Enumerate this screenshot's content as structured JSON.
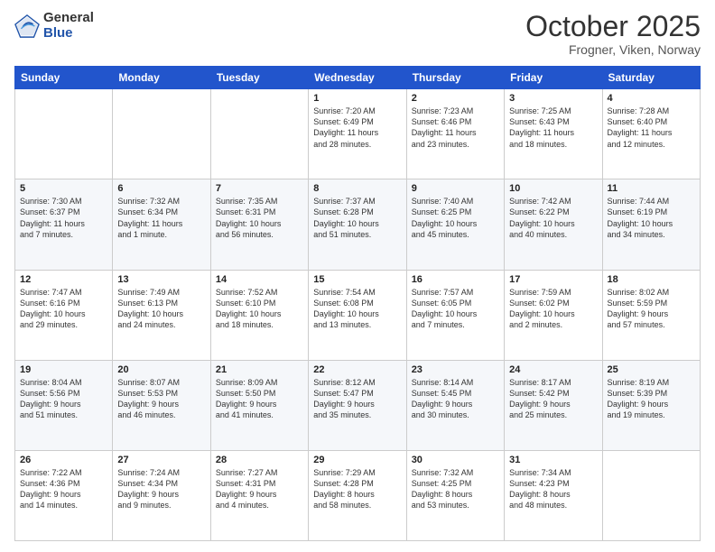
{
  "logo": {
    "general": "General",
    "blue": "Blue"
  },
  "title": "October 2025",
  "subtitle": "Frogner, Viken, Norway",
  "weekdays": [
    "Sunday",
    "Monday",
    "Tuesday",
    "Wednesday",
    "Thursday",
    "Friday",
    "Saturday"
  ],
  "weeks": [
    [
      {
        "day": "",
        "info": ""
      },
      {
        "day": "",
        "info": ""
      },
      {
        "day": "",
        "info": ""
      },
      {
        "day": "1",
        "info": "Sunrise: 7:20 AM\nSunset: 6:49 PM\nDaylight: 11 hours\nand 28 minutes."
      },
      {
        "day": "2",
        "info": "Sunrise: 7:23 AM\nSunset: 6:46 PM\nDaylight: 11 hours\nand 23 minutes."
      },
      {
        "day": "3",
        "info": "Sunrise: 7:25 AM\nSunset: 6:43 PM\nDaylight: 11 hours\nand 18 minutes."
      },
      {
        "day": "4",
        "info": "Sunrise: 7:28 AM\nSunset: 6:40 PM\nDaylight: 11 hours\nand 12 minutes."
      }
    ],
    [
      {
        "day": "5",
        "info": "Sunrise: 7:30 AM\nSunset: 6:37 PM\nDaylight: 11 hours\nand 7 minutes."
      },
      {
        "day": "6",
        "info": "Sunrise: 7:32 AM\nSunset: 6:34 PM\nDaylight: 11 hours\nand 1 minute."
      },
      {
        "day": "7",
        "info": "Sunrise: 7:35 AM\nSunset: 6:31 PM\nDaylight: 10 hours\nand 56 minutes."
      },
      {
        "day": "8",
        "info": "Sunrise: 7:37 AM\nSunset: 6:28 PM\nDaylight: 10 hours\nand 51 minutes."
      },
      {
        "day": "9",
        "info": "Sunrise: 7:40 AM\nSunset: 6:25 PM\nDaylight: 10 hours\nand 45 minutes."
      },
      {
        "day": "10",
        "info": "Sunrise: 7:42 AM\nSunset: 6:22 PM\nDaylight: 10 hours\nand 40 minutes."
      },
      {
        "day": "11",
        "info": "Sunrise: 7:44 AM\nSunset: 6:19 PM\nDaylight: 10 hours\nand 34 minutes."
      }
    ],
    [
      {
        "day": "12",
        "info": "Sunrise: 7:47 AM\nSunset: 6:16 PM\nDaylight: 10 hours\nand 29 minutes."
      },
      {
        "day": "13",
        "info": "Sunrise: 7:49 AM\nSunset: 6:13 PM\nDaylight: 10 hours\nand 24 minutes."
      },
      {
        "day": "14",
        "info": "Sunrise: 7:52 AM\nSunset: 6:10 PM\nDaylight: 10 hours\nand 18 minutes."
      },
      {
        "day": "15",
        "info": "Sunrise: 7:54 AM\nSunset: 6:08 PM\nDaylight: 10 hours\nand 13 minutes."
      },
      {
        "day": "16",
        "info": "Sunrise: 7:57 AM\nSunset: 6:05 PM\nDaylight: 10 hours\nand 7 minutes."
      },
      {
        "day": "17",
        "info": "Sunrise: 7:59 AM\nSunset: 6:02 PM\nDaylight: 10 hours\nand 2 minutes."
      },
      {
        "day": "18",
        "info": "Sunrise: 8:02 AM\nSunset: 5:59 PM\nDaylight: 9 hours\nand 57 minutes."
      }
    ],
    [
      {
        "day": "19",
        "info": "Sunrise: 8:04 AM\nSunset: 5:56 PM\nDaylight: 9 hours\nand 51 minutes."
      },
      {
        "day": "20",
        "info": "Sunrise: 8:07 AM\nSunset: 5:53 PM\nDaylight: 9 hours\nand 46 minutes."
      },
      {
        "day": "21",
        "info": "Sunrise: 8:09 AM\nSunset: 5:50 PM\nDaylight: 9 hours\nand 41 minutes."
      },
      {
        "day": "22",
        "info": "Sunrise: 8:12 AM\nSunset: 5:47 PM\nDaylight: 9 hours\nand 35 minutes."
      },
      {
        "day": "23",
        "info": "Sunrise: 8:14 AM\nSunset: 5:45 PM\nDaylight: 9 hours\nand 30 minutes."
      },
      {
        "day": "24",
        "info": "Sunrise: 8:17 AM\nSunset: 5:42 PM\nDaylight: 9 hours\nand 25 minutes."
      },
      {
        "day": "25",
        "info": "Sunrise: 8:19 AM\nSunset: 5:39 PM\nDaylight: 9 hours\nand 19 minutes."
      }
    ],
    [
      {
        "day": "26",
        "info": "Sunrise: 7:22 AM\nSunset: 4:36 PM\nDaylight: 9 hours\nand 14 minutes."
      },
      {
        "day": "27",
        "info": "Sunrise: 7:24 AM\nSunset: 4:34 PM\nDaylight: 9 hours\nand 9 minutes."
      },
      {
        "day": "28",
        "info": "Sunrise: 7:27 AM\nSunset: 4:31 PM\nDaylight: 9 hours\nand 4 minutes."
      },
      {
        "day": "29",
        "info": "Sunrise: 7:29 AM\nSunset: 4:28 PM\nDaylight: 8 hours\nand 58 minutes."
      },
      {
        "day": "30",
        "info": "Sunrise: 7:32 AM\nSunset: 4:25 PM\nDaylight: 8 hours\nand 53 minutes."
      },
      {
        "day": "31",
        "info": "Sunrise: 7:34 AM\nSunset: 4:23 PM\nDaylight: 8 hours\nand 48 minutes."
      },
      {
        "day": "",
        "info": ""
      }
    ]
  ]
}
